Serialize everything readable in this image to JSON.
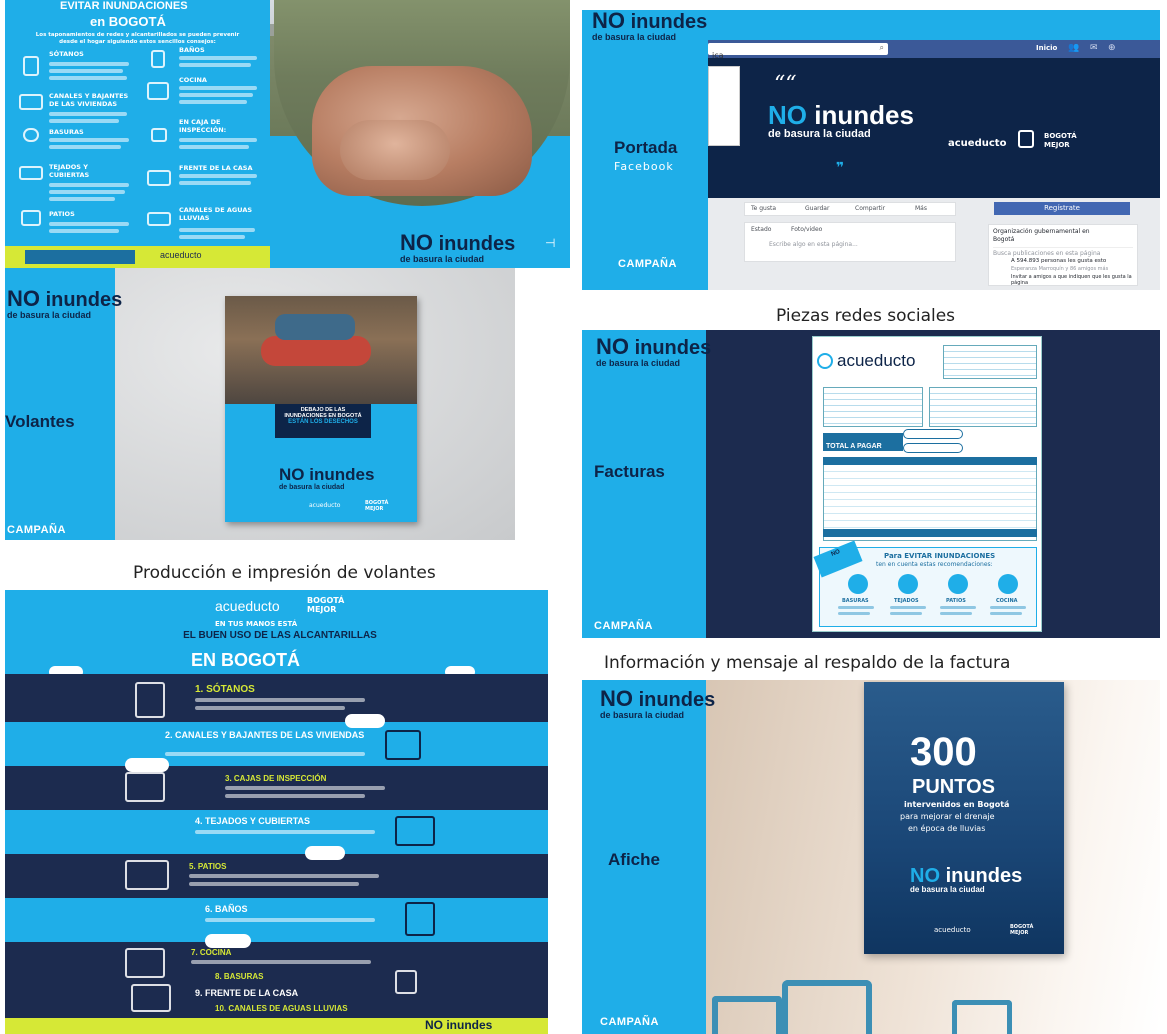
{
  "colors": {
    "cyan": "#1faee8",
    "navy": "#1c2b4f",
    "darknavy": "#0d2448",
    "yellow": "#d6e836"
  },
  "brand": {
    "no": "NO",
    "inundes": "inundes",
    "tagline": "de basura la ciudad",
    "campaign": "CAMPAÑA",
    "acueducto": "acueducto",
    "bogota_mejor": "BOGOTÁ MEJOR"
  },
  "poster_top_left": {
    "title_line1": "EVITAR INUNDACIONES",
    "title_line2": "en BOGOTÁ",
    "intro": "Los taponamientos de redes y alcantarillados se pueden prevenir desde el hogar siguiendo estos sencillos consejos:",
    "items_left": [
      "SÓTANOS",
      "CANALES Y BAJANTES DE LAS VIVIENDAS",
      "BASURAS",
      "TEJADOS Y CUBIERTAS",
      "PATIOS"
    ],
    "items_right": [
      "BAÑOS",
      "COCINA",
      "EN CAJA DE INSPECCIÓN:",
      "FRENTE DE LA CASA",
      "CANALES DE AGUAS LLUVIAS"
    ]
  },
  "facebook": {
    "panel_label": "Portada",
    "panel_sub": "Facebook",
    "search_text": "ica",
    "nav_right": "Inicio",
    "cover_quote": "““",
    "tabs": [
      "Te gusta",
      "Guardar",
      "Compartir",
      "Más"
    ],
    "register": "Regístrate",
    "status": "Estado",
    "photo_video": "Foto/video",
    "write": "Escribe algo en esta página...",
    "org": "Organización gubernamental en Bogotá",
    "search_posts": "Busca publicaciones en esta página",
    "likes": "A 594.893 personas les gusta esto",
    "likes_sub": "Esperanza Marroquín y 86 amigos más",
    "invite": "Invitar a amigos a que indiquen que les gusta la página"
  },
  "caption_social": "Piezas redes sociales",
  "flyer": {
    "panel_label": "Volantes",
    "box_line1": "DEBAJO DE LAS",
    "box_line2": "INUNDACIONES EN BOGOTÁ",
    "box_line3": "ESTÁN LOS DESECHOS"
  },
  "caption_flyer": "Producción e impresión de volantes",
  "bill": {
    "panel_label": "Facturas",
    "total": "TOTAL A PAGAR",
    "back_title1": "Para EVITAR INUNDACIONES",
    "back_title2": "ten en cuenta estas recomendaciones:",
    "icons": [
      "BASURAS",
      "TEJADOS",
      "PATIOS",
      "COCINA"
    ]
  },
  "caption_bill": "Información y mensaje al respaldo de la factura",
  "infographic": {
    "header1": "EN TUS MANOS ESTÁ",
    "header2": "EL BUEN USO DE LAS ALCANTARILLAS",
    "header3": "EN BOGOTÁ",
    "steps": [
      "1. SÓTANOS",
      "2. CANALES Y BAJANTES DE LAS VIVIENDAS",
      "3. CAJAS DE INSPECCIÓN",
      "4. TEJADOS Y CUBIERTAS",
      "5. PATIOS",
      "6. BAÑOS",
      "7. COCINA",
      "8. BASURAS",
      "9. FRENTE DE LA CASA",
      "10. CANALES DE AGUAS LLUVIAS"
    ],
    "footer_right": "NO inundes"
  },
  "poster": {
    "panel_label": "Afiche",
    "number": "300",
    "puntos": "PUNTOS",
    "l1": "intervenidos en Bogotá",
    "l2": "para mejorar el drenaje",
    "l3": "en época de lluvias"
  }
}
